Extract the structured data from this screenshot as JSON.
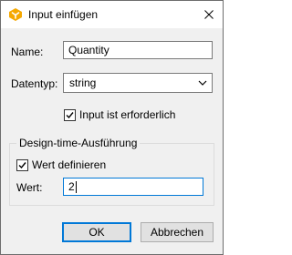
{
  "window": {
    "title": "Input einfügen",
    "icon": "altova-logo-icon",
    "close_icon": "close-icon"
  },
  "form": {
    "name_label": "Name:",
    "name_value": "Quantity",
    "datatype_label": "Datentyp:",
    "datatype_value": "string",
    "required_label": "Input ist erforderlich",
    "required_checked": true
  },
  "design_time": {
    "group_title": "Design-time-Ausführung",
    "define_value_label": "Wert definieren",
    "define_value_checked": true,
    "value_label": "Wert:",
    "value": "2"
  },
  "buttons": {
    "ok_label": "OK",
    "cancel_label": "Abbrechen"
  },
  "colors": {
    "logo_orange": "#f5a800",
    "focus_border": "#0078d7"
  }
}
